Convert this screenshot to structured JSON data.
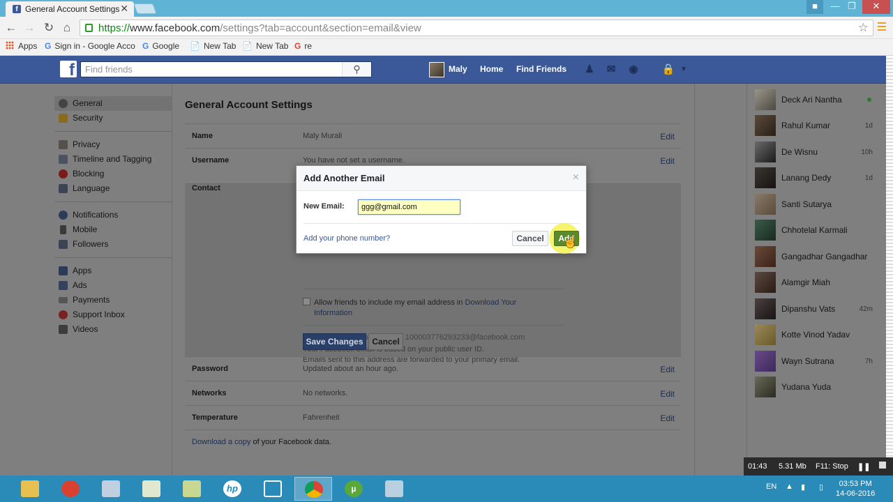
{
  "browser": {
    "tab_title": "General Account Settings",
    "tab_close": "✕",
    "url_green": "https://",
    "url_host": "www.facebook.com",
    "url_path": "/settings?tab=account&section=email&view",
    "bookmarks": {
      "apps": "Apps",
      "b1": "Sign in - Google Acco",
      "b2": "Google",
      "b3": "New Tab",
      "b4": "New Tab",
      "b5": "re"
    }
  },
  "fbbar": {
    "search_placeholder": "Find friends",
    "user": "Maly",
    "home": "Home",
    "find_friends": "Find Friends"
  },
  "leftnav": {
    "general": "General",
    "security": "Security",
    "privacy": "Privacy",
    "timeline": "Timeline and Tagging",
    "blocking": "Blocking",
    "language": "Language",
    "notifications": "Notifications",
    "mobile": "Mobile",
    "followers": "Followers",
    "apps": "Apps",
    "ads": "Ads",
    "payments": "Payments",
    "support": "Support Inbox",
    "videos": "Videos"
  },
  "settings": {
    "title": "General Account Settings",
    "name_label": "Name",
    "name_value": "Maly Murali",
    "username_label": "Username",
    "username_value": "You have not set a username.",
    "contact_label": "Contact",
    "edit": "Edit",
    "fb_email_line": "Use your Facebook email: 100003776293233@facebook.com",
    "fb_email_info1": "Your Facebook email is based on your public user ID.",
    "fb_email_info2": "Emails sent to this address are forwarded to your primary email.",
    "allow_text": "Allow friends to include my email address in ",
    "allow_link": "Download Your",
    "allow_link2": "Information",
    "save_changes": "Save Changes",
    "cancel": "Cancel",
    "password_label": "Password",
    "password_value": "Updated about an hour ago.",
    "networks_label": "Networks",
    "networks_value": "No networks.",
    "temperature_label": "Temperature",
    "temperature_value": "Fahrenheit",
    "download_text": "Download a copy",
    "download_rest": " of your Facebook data."
  },
  "chat": {
    "friends": [
      {
        "name": "Deck Ari Nantha",
        "time": ""
      },
      {
        "name": "Rahul Kumar",
        "time": "1d"
      },
      {
        "name": "De Wisnu",
        "time": "10h"
      },
      {
        "name": "Lanang Dedy",
        "time": "1d"
      },
      {
        "name": "Santi Sutarya",
        "time": ""
      },
      {
        "name": "Chhotelal Karmali",
        "time": ""
      },
      {
        "name": "Gangadhar Gangadhar",
        "time": ""
      },
      {
        "name": "Alamgir Miah",
        "time": ""
      },
      {
        "name": "Dipanshu Vats",
        "time": "42m"
      },
      {
        "name": "Kotte Vinod Yadav",
        "time": ""
      },
      {
        "name": "Wayn Sutrana",
        "time": "7h"
      },
      {
        "name": "Yudana Yuda",
        "time": ""
      }
    ]
  },
  "modal": {
    "title": "Add Another Email",
    "close": "×",
    "label": "New Email:",
    "value": "ggg@gmail.com",
    "phone_link": "Add your phone number?",
    "cancel": "Cancel",
    "add": "Add"
  },
  "recorder": {
    "time": "01:43",
    "size": "5.31 Mb",
    "stop": "F11: Stop"
  },
  "taskbar": {
    "lang": "EN",
    "time": "03:53 PM",
    "date": "14-06-2016"
  }
}
